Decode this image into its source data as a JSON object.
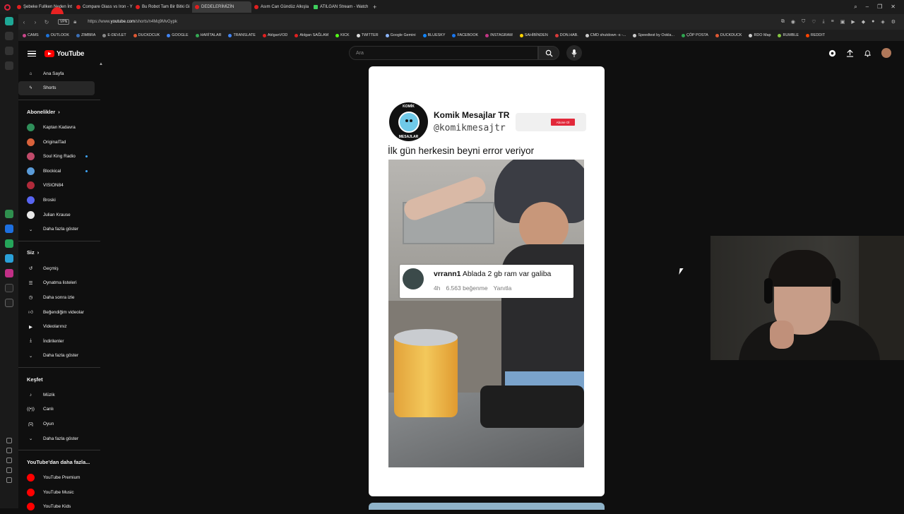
{
  "browser": {
    "tabs": [
      {
        "label": "Şebeke Fullken Neden İnt",
        "active": false
      },
      {
        "label": "Compare Glass vs Iron - Y",
        "active": false
      },
      {
        "label": "Bu Robot Tam Bir Bitki Gi",
        "active": false
      },
      {
        "label": "DEDELERİMİZİN",
        "active": true
      },
      {
        "label": "Asım Can Gündüz Alkışla",
        "active": false
      },
      {
        "label": "ATILGAN Stream - Watch",
        "active": false
      }
    ],
    "new_tab": "+",
    "url_prefix": "https://www.",
    "url_domain": "youtube.com",
    "url_path": "/shorts/n4Mq9MvGypk",
    "vpn_label": "VPN",
    "bookmarks": [
      {
        "label": "CAMS",
        "color": "#c9468a"
      },
      {
        "label": "OUTLOOK",
        "color": "#1d72d8"
      },
      {
        "label": "ZIMBRA",
        "color": "#3b6fb6"
      },
      {
        "label": "E-DEVLET",
        "color": "#888888"
      },
      {
        "label": "DUCKDCUK",
        "color": "#de5833"
      },
      {
        "label": "GOOGLE",
        "color": "#4285f4"
      },
      {
        "label": "HARİTALAR",
        "color": "#34a853"
      },
      {
        "label": "TRANSLATE",
        "color": "#4285f4"
      },
      {
        "label": "AtılganVOD",
        "color": "#e02020"
      },
      {
        "label": "Atılgan SAĞLAM",
        "color": "#e02020"
      },
      {
        "label": "KICK",
        "color": "#53fc18"
      },
      {
        "label": "TWITTER",
        "color": "#dddddd"
      },
      {
        "label": "Google Gemini",
        "color": "#8ab4f8"
      },
      {
        "label": "BLUESKY",
        "color": "#1185fe"
      },
      {
        "label": "FACEBOOK",
        "color": "#1877f2"
      },
      {
        "label": "INSTAGRAM",
        "color": "#c13584"
      },
      {
        "label": "SAHİBİNDEN",
        "color": "#ffd400"
      },
      {
        "label": "DON.HAB.",
        "color": "#d83a3a"
      },
      {
        "label": "CMD shutdown -s -...",
        "color": "#cccccc"
      },
      {
        "label": "Speedtest by Ookla...",
        "color": "#cccccc"
      },
      {
        "label": "ÇÖP POSTA",
        "color": "#2ea44f"
      },
      {
        "label": "DUCKDUCK",
        "color": "#de5833"
      },
      {
        "label": "RDO Map",
        "color": "#cccccc"
      },
      {
        "label": "RUMBLE",
        "color": "#85c742"
      },
      {
        "label": "REDDIT",
        "color": "#ff4500"
      }
    ]
  },
  "youtube": {
    "logo_text": "YouTube",
    "search_placeholder": "Ara",
    "sidebar": {
      "main": [
        {
          "label": "Ana Sayfa",
          "icon": "home-icon",
          "active": false
        },
        {
          "label": "Shorts",
          "icon": "shorts-icon",
          "active": true
        }
      ],
      "subscriptions_title": "Abonelikler",
      "subscriptions": [
        {
          "label": "Kaptan Kadavra",
          "color": "#2f8f5a",
          "new": false
        },
        {
          "label": "OriginalTad",
          "color": "#d9623b",
          "new": false
        },
        {
          "label": "Soul King Radio",
          "color": "#c04a6a",
          "new": true
        },
        {
          "label": "Blockical",
          "color": "#5a9bd8",
          "new": true
        },
        {
          "label": "VISION84",
          "color": "#b02a3a",
          "new": false
        },
        {
          "label": "Broski",
          "color": "#5865f2",
          "new": false
        },
        {
          "label": "Julian Krause",
          "color": "#e8e8e8",
          "new": false
        }
      ],
      "subscriptions_more": "Daha fazla göster",
      "you_title": "Siz",
      "you": [
        {
          "label": "Geçmiş",
          "icon": "history-icon"
        },
        {
          "label": "Oynatma listeleri",
          "icon": "playlists-icon"
        },
        {
          "label": "Daha sonra izle",
          "icon": "watch-later-icon"
        },
        {
          "label": "Beğendiğim videolar",
          "icon": "liked-icon"
        },
        {
          "label": "Videolarınız",
          "icon": "your-videos-icon"
        },
        {
          "label": "İndirilenler",
          "icon": "downloads-icon"
        },
        {
          "label": "Daha fazla göster",
          "icon": "chevron-down-icon"
        }
      ],
      "explore_title": "Keşfet",
      "explore": [
        {
          "label": "Müzik",
          "icon": "music-icon"
        },
        {
          "label": "Canlı",
          "icon": "live-icon"
        },
        {
          "label": "Oyun",
          "icon": "gaming-icon"
        },
        {
          "label": "Daha fazla göster",
          "icon": "chevron-down-icon"
        }
      ],
      "more_title": "YouTube'dan daha fazla...",
      "more": [
        {
          "label": "YouTube Premium"
        },
        {
          "label": "YouTube Music"
        },
        {
          "label": "YouTube Kids"
        }
      ]
    },
    "short": {
      "channel_name": "Komik Mesajlar TR",
      "channel_handle": "@komikmesajtr",
      "subscribe_label": "Abone Ol",
      "caption": "İlk gün herkesin beyni error veriyor",
      "logo_top": "KOMİK",
      "logo_bottom": "MESAJLAR",
      "comment": {
        "user": "vrrann1",
        "text": "Ablada 2 gb ram var galiba",
        "time": "4h",
        "likes": "6.563 beğenme",
        "reply": "Yanıtla"
      }
    }
  }
}
